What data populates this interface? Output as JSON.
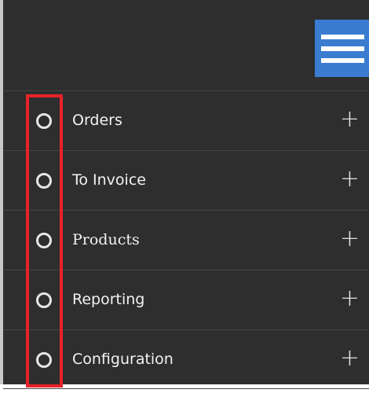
{
  "menu": {
    "items": [
      {
        "label": "Orders",
        "expand_icon": "plus-icon"
      },
      {
        "label": "To Invoice",
        "expand_icon": "plus-icon"
      },
      {
        "label": "Products",
        "expand_icon": "plus-icon"
      },
      {
        "label": "Reporting",
        "expand_icon": "plus-icon"
      },
      {
        "label": "Configuration",
        "expand_icon": "plus-icon"
      }
    ],
    "expand_symbol": "+"
  },
  "colors": {
    "panel_background": "#2e2e2e",
    "hamburger_background": "#3a7ccf",
    "highlight_border": "#e8222a",
    "text": "#f2f2f2"
  }
}
